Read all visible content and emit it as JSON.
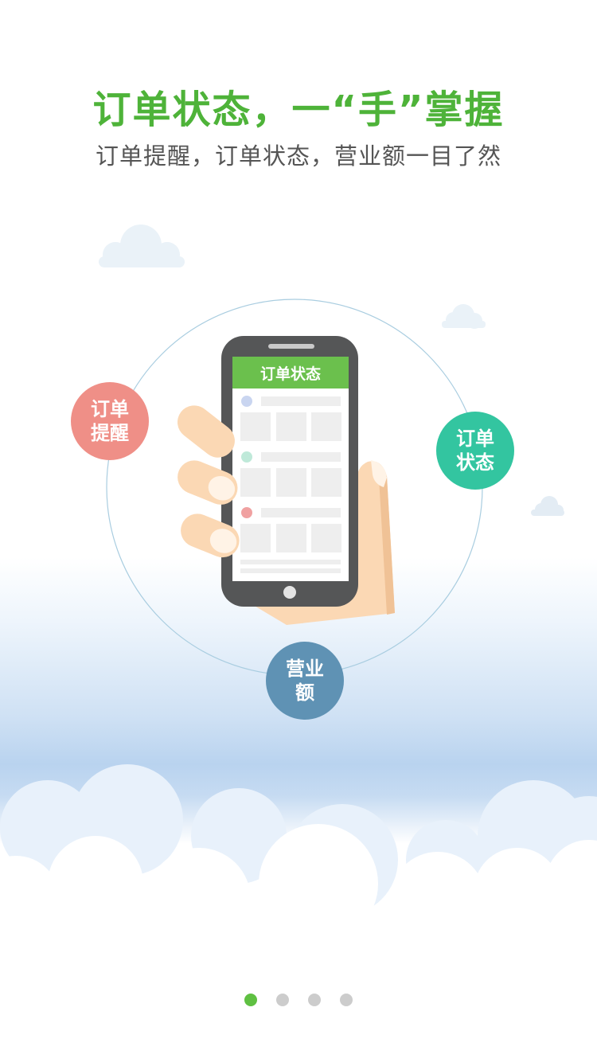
{
  "header": {
    "title": "订单状态，一“手”掌握",
    "subtitle": "订单提醒，订单状态，营业额一目了然"
  },
  "phone": {
    "screen_title": "订单状态"
  },
  "features": [
    {
      "line1": "订单",
      "line2": "提醒",
      "color": "#ef8f87"
    },
    {
      "line1": "订单",
      "line2": "状态",
      "color": "#33c5a0"
    },
    {
      "line1": "营业",
      "line2": "额",
      "color": "#5f92b4"
    }
  ],
  "pager": {
    "total": 4,
    "active_index": 0,
    "active_color": "#5fc042",
    "inactive_color": "#cccccc"
  },
  "colors": {
    "title": "#4eb339",
    "subtitle": "#555555",
    "phone_header": "#6bc04d",
    "phone_body": "#555657",
    "skin": "#fbd8b4"
  }
}
